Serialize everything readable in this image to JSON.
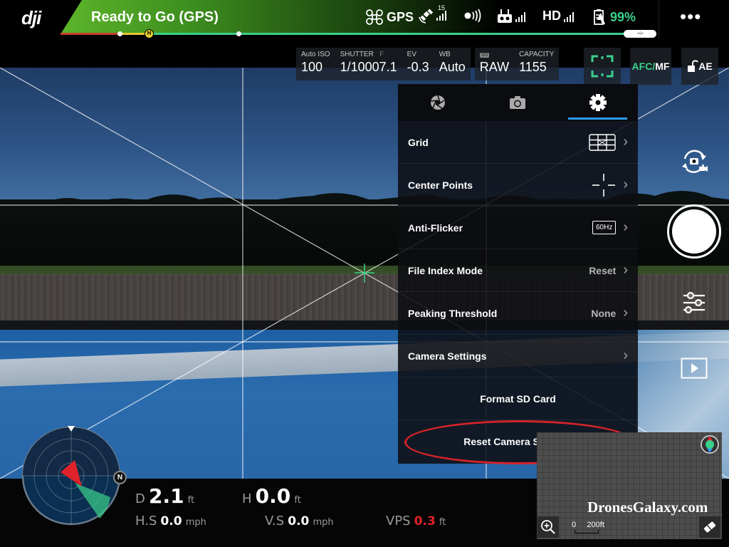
{
  "topbar": {
    "logo": "dji",
    "status": "Ready to Go (GPS)",
    "home_marker": "H",
    "aircraft_label": "GPS",
    "satellites": "15",
    "battery_percent": "99%",
    "hd_label": "HD",
    "more_label": "•••",
    "end_pill": "--:--",
    "icons": [
      "aircraft-icon",
      "satellite-icon",
      "vision-sensor-icon",
      "remote-controller-icon",
      "hd-signal-icon",
      "battery-icon",
      "more-icon"
    ],
    "colors": {
      "ready": "#5db52a",
      "battery": "#3ad08a",
      "progress_green": "#3ad08a",
      "progress_yellow": "#e5c732",
      "progress_red": "#c2412a"
    }
  },
  "camera_params": {
    "iso": {
      "label": "Auto ISO",
      "value": "100"
    },
    "shutter": {
      "label": "SHUTTER",
      "value": "1/1000"
    },
    "aperture": {
      "label": "F",
      "value": "7.1"
    },
    "ev": {
      "label": "EV",
      "value": "-0.3"
    },
    "wb": {
      "label": "WB",
      "value": "Auto"
    },
    "format": {
      "label": "SD",
      "value": "RAW"
    },
    "capacity": {
      "label": "CAPACITY",
      "value": "1155"
    },
    "focus_mode": {
      "afc": "AFC",
      "sep": "/",
      "mf": "MF"
    },
    "ae_lock": "AE"
  },
  "settings_panel": {
    "tabs": [
      {
        "name": "aperture-tab",
        "icon": "aperture-icon",
        "active": false
      },
      {
        "name": "photo-tab",
        "icon": "camera-icon",
        "active": false
      },
      {
        "name": "settings-tab",
        "icon": "gear-icon",
        "active": true
      }
    ],
    "rows": [
      {
        "label": "Grid",
        "value": "",
        "chevron": true
      },
      {
        "label": "Center Points",
        "value": "",
        "chevron": true
      },
      {
        "label": "Anti-Flicker",
        "value": "60Hz",
        "chevron": true
      },
      {
        "label": "File Index Mode",
        "value": "Reset",
        "chevron": true
      },
      {
        "label": "Peaking Threshold",
        "value": "None",
        "chevron": true
      },
      {
        "label": "Camera Settings",
        "value": "",
        "chevron": true
      },
      {
        "label": "Format SD Card",
        "value": "",
        "chevron": false
      },
      {
        "label": "Reset Camera Settings",
        "value": "",
        "chevron": false
      }
    ],
    "chevron_glyph": "›",
    "highlight_color": "#d2232a"
  },
  "telemetry": {
    "distance": {
      "key": "D",
      "value": "2.1",
      "unit": "ft"
    },
    "height": {
      "key": "H",
      "value": "0.0",
      "unit": "ft"
    },
    "h_speed": {
      "key": "H.S",
      "value": "0.0",
      "unit": "mph"
    },
    "v_speed": {
      "key": "V.S",
      "value": "0.0",
      "unit": "mph"
    },
    "vps": {
      "key": "VPS",
      "value": "0.3",
      "unit": "ft"
    }
  },
  "radar": {
    "north_label": "N"
  },
  "minimap": {
    "watermark": "DronesGalaxy.com",
    "scale_start": "0",
    "scale_end": "200ft"
  }
}
